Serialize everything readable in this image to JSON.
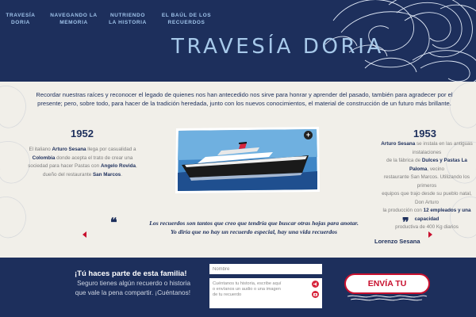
{
  "nav": {
    "items": [
      {
        "label": "TRAVESÍA DORIA"
      },
      {
        "label": "NAVEGANDO LA MEMORIA"
      },
      {
        "label": "NUTRIENDO LA HISTORIA"
      },
      {
        "label": "EL BAÚL DE LOS RECUERDOS"
      }
    ]
  },
  "header": {
    "title": "TRAVESÍA DORIA"
  },
  "intro": {
    "text": "Recordar nuestras raíces y reconocer el legado de quienes nos han antecedido nos sirve para honrar y aprender del pasado, también para agradecer por el\npresente; pero, sobre todo, para hacer de la tradición heredada, junto con los nuevos conocimientos, el material de construcción de un futuro más brillante."
  },
  "timeline": {
    "left": {
      "year": "1952",
      "parts": [
        "El italiano ",
        "Arturo Sesana",
        " llega por casualidad a ",
        "Colombia",
        " donde acepta el trato de crear una sociedad para hacer Pastas con ",
        "Angelo Rovida",
        ", dueño del restaurante ",
        "San Marcos",
        "."
      ]
    },
    "right": {
      "year": "1953",
      "parts": [
        "Arturo Sesana",
        " se instala en las antiguas instalaciones\nde la fábrica de ",
        "Dulces y Pastas La Paloma",
        ", vecino\nrestaurante  San Marcos. Utilizando los primeros\nequipos que trajo  desde su pueblo natal, Don Arturo\nla producción con  ",
        "12 empleados y una capacidad",
        "\nproductiva de 400 Kg diarios"
      ]
    }
  },
  "photo": {
    "expand_symbol": "+"
  },
  "quote": {
    "open_mark": "❝",
    "close_mark": "❞",
    "text": "Los recuerdos son tantos que creo que tendría que buscar otras hojas para anotar.\nYo diría que no hay un recuerdo especial, hay una vida recuerdos",
    "author": "Lorenzo Sesana"
  },
  "footer": {
    "cta_title": "¡Tú haces parte de esta familia!",
    "cta_text": "Seguro tienes algún recuerdo o historia\nque vale la pena compartir. ¡Cuéntanos!",
    "name_placeholder": "Nombre",
    "message_placeholder": "Cuéntanos tu historia, escribe aquí\no envíanos un audio o una imagen\nde tu recuerdo",
    "send_label": "ENVÍA TU RECUERDO"
  },
  "colors": {
    "navy": "#1d2f5c",
    "nav_text": "#9fc3ea",
    "accent_red": "#c8102e",
    "background": "#f1efe9"
  },
  "icons": {
    "audio": "microphone-icon",
    "video": "camera-icon",
    "expand": "plus-circle-icon",
    "prev": "chevron-left-icon",
    "next": "chevron-right-icon"
  }
}
